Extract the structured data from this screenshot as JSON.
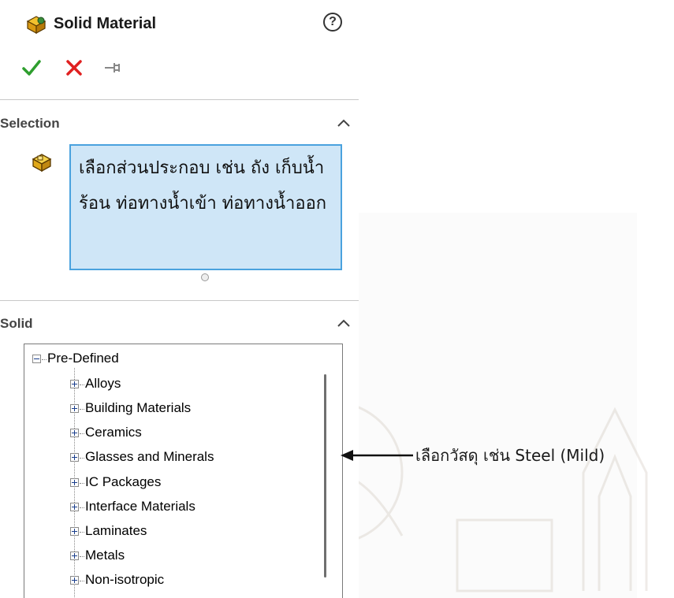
{
  "panel": {
    "title": "Solid Material",
    "help_label": "?",
    "actions": {
      "ok_icon": "check-icon",
      "cancel_icon": "x-icon",
      "pin_icon": "pushpin-icon"
    }
  },
  "selection": {
    "header": "Selection",
    "field_value": "เลือกส่วนประกอบ เช่น ถัง เก็บน้ำร้อน ท่อทางน้ำเข้า ท่อทางน้ำออก"
  },
  "solid": {
    "header": "Solid",
    "tree": {
      "root": "Pre-Defined",
      "children": [
        "Alloys",
        "Building Materials",
        "Ceramics",
        "Glasses and Minerals",
        "IC Packages",
        "Interface Materials",
        "Laminates",
        "Metals",
        "Non-isotropic"
      ]
    }
  },
  "annotation": {
    "text": "เลือกวัสดุ เช่น Steel (Mild)"
  },
  "colors": {
    "selection_bg": "#cfe6f7",
    "selection_border": "#4aa2de",
    "ok_green": "#2e9e2e",
    "cancel_red": "#e02020"
  }
}
